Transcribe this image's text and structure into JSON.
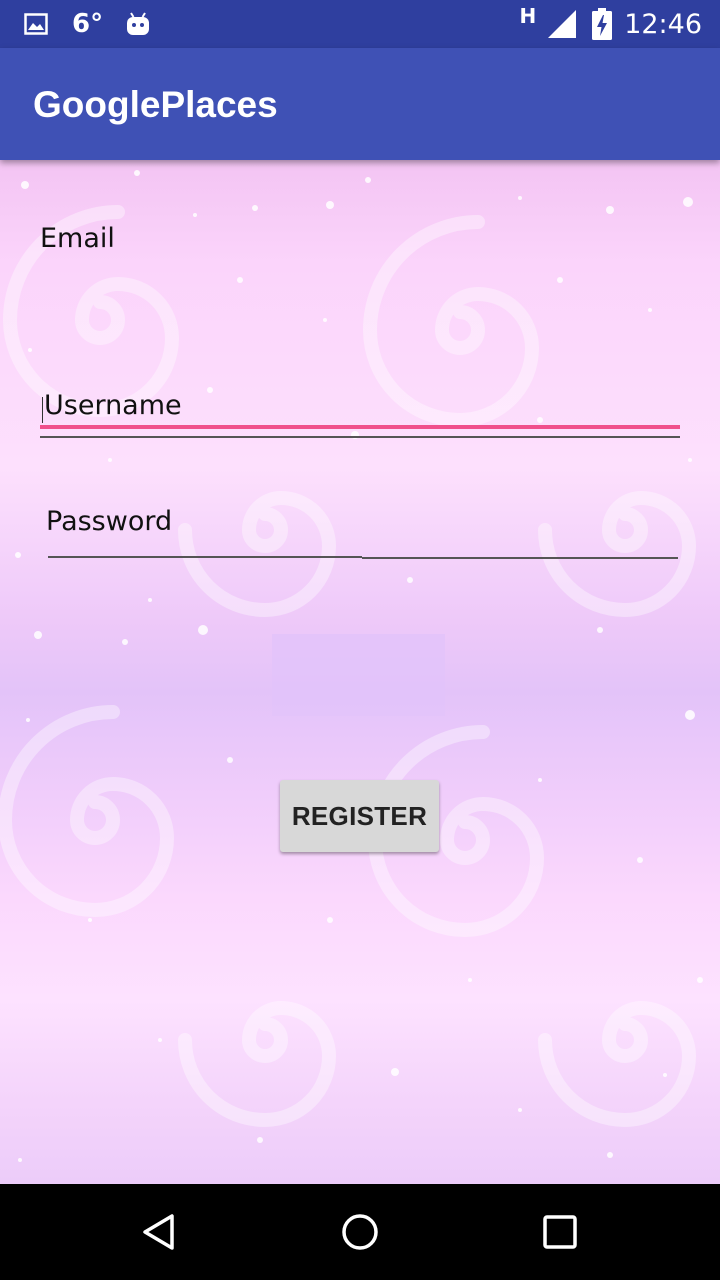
{
  "status_bar": {
    "temperature": "6°",
    "network": "H",
    "time": "12:46",
    "icons": [
      "image-icon",
      "android-icon",
      "signal-icon",
      "battery-charging-icon"
    ]
  },
  "app_bar": {
    "title": "GooglePlaces",
    "color": "#3f51b5"
  },
  "form": {
    "email_placeholder": "Email",
    "username_placeholder": "Username",
    "password_placeholder": "Password",
    "register_label": "REGISTER",
    "accent_color": "#f0508c"
  },
  "nav_bar": {
    "icons": [
      "back-icon",
      "home-icon",
      "recents-icon"
    ]
  }
}
